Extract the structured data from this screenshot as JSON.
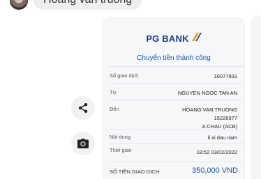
{
  "chat": {
    "message": "Hoang van truong"
  },
  "actions": {
    "share_icon": "share-icon",
    "camera_icon": "camera-icon"
  },
  "receipt": {
    "bank_name": "PG BANK",
    "status": "Chuyển tiền thành công",
    "rows": [
      {
        "label": "Số giao dịch",
        "value": "16077931"
      },
      {
        "label": "Từ",
        "value": "NGUYEN NGOC TAN AN"
      },
      {
        "label": "Đến",
        "value_lines": [
          "HOANG VAN TRUONG",
          "15226977",
          "A CHAU (ACB)"
        ]
      },
      {
        "label": "Nội dung",
        "value": "li xi dau nam"
      },
      {
        "label": "Thời gian",
        "value": "18:52 03/02/2022"
      }
    ],
    "total_label": "SỐ TIỀN GIAO DỊCH",
    "total_value": "350,000 VND"
  },
  "colors": {
    "brand_blue": "#1b3f8f",
    "accent_blue": "#1c57a5",
    "logo_orange": "#f39a1e"
  }
}
